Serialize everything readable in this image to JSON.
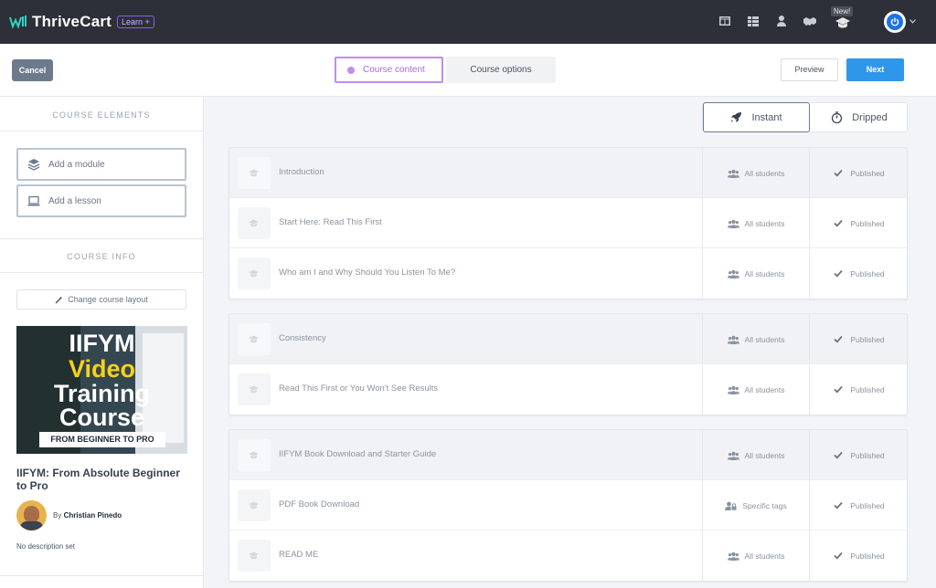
{
  "topbar": {
    "brand": "ThriveCart",
    "learn_badge": "Learn +",
    "new_badge": "New!"
  },
  "header": {
    "cancel": "Cancel",
    "tab_content": "Course content",
    "tab_options": "Course options",
    "preview": "Preview",
    "next": "Next"
  },
  "sidebar": {
    "elements_title": "COURSE ELEMENTS",
    "add_module": "Add a module",
    "add_lesson": "Add a lesson",
    "info_title": "COURSE INFO",
    "change_layout": "Change course layout",
    "thumbnail": {
      "line1": "IIFYM",
      "line2": "Video",
      "line3": "Training",
      "line4": "Course",
      "line5": "FROM BEGINNER TO PRO"
    },
    "course_name": "IIFYM: From Absolute Beginner to Pro",
    "author_prefix": "By ",
    "author_name": "Christian Pinedo",
    "description": "No description set"
  },
  "release_toggle": {
    "instant": "Instant",
    "dripped": "Dripped"
  },
  "modules": [
    {
      "rows": [
        {
          "title": "Introduction",
          "access": "All students",
          "status": "Published"
        },
        {
          "title": "Start Here: Read This First",
          "access": "All students",
          "status": "Published"
        },
        {
          "title": "Who am I and Why Should You Listen To Me?",
          "access": "All students",
          "status": "Published"
        }
      ]
    },
    {
      "rows": [
        {
          "title": "Consistency",
          "access": "All students",
          "status": "Published"
        },
        {
          "title": "Read This First or You Won't See Results",
          "access": "All students",
          "status": "Published"
        }
      ]
    },
    {
      "rows": [
        {
          "title": "IIFYM Book Download and Starter Guide",
          "access": "All students",
          "status": "Published"
        },
        {
          "title": "PDF Book Download",
          "access": "Specific tags",
          "status": "Published"
        },
        {
          "title": "READ ME",
          "access": "All students",
          "status": "Published"
        }
      ]
    }
  ],
  "colors": {
    "topbar": "#2d3038",
    "accent_purple": "#c08cf0",
    "next_blue": "#2f97ea",
    "cancel_gray": "#6c7a8c"
  }
}
